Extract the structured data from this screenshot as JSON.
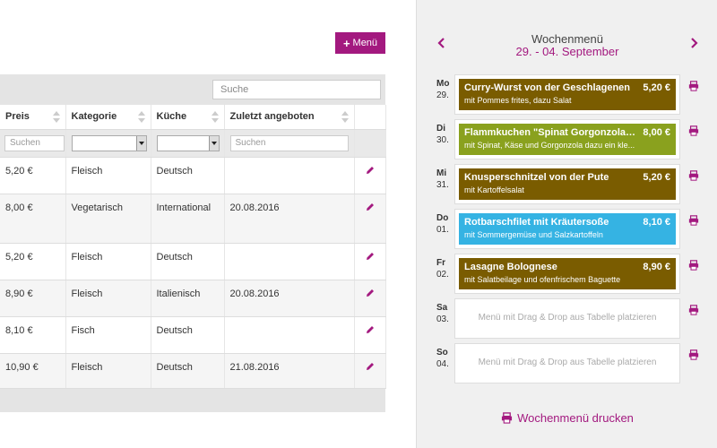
{
  "colors": {
    "accent": "#a3197f",
    "fleisch": "#7a5c00",
    "vegetarisch": "#8aa11e",
    "fisch": "#35b3e3"
  },
  "toolbar": {
    "add_menu_label": "Menü"
  },
  "table": {
    "search_placeholder": "Suche",
    "headers": [
      "Preis",
      "Kategorie",
      "Küche",
      "Zuletzt angeboten"
    ],
    "filter_placeholder": "Suchen",
    "rows": [
      {
        "price": "5,20 €",
        "category": "Fleisch",
        "cuisine": "Deutsch",
        "last": ""
      },
      {
        "price": "8,00 €",
        "category": "Vegetarisch",
        "cuisine": "International",
        "last": "20.08.2016"
      },
      {
        "price": "5,20 €",
        "category": "Fleisch",
        "cuisine": "Deutsch",
        "last": ""
      },
      {
        "price": "8,90 €",
        "category": "Fleisch",
        "cuisine": "Italienisch",
        "last": "20.08.2016"
      },
      {
        "price": "8,10 €",
        "category": "Fisch",
        "cuisine": "Deutsch",
        "last": ""
      },
      {
        "price": "10,90 €",
        "category": "Fleisch",
        "cuisine": "Deutsch",
        "last": "21.08.2016"
      }
    ]
  },
  "week": {
    "title": "Wochenmenü",
    "range": "29. - 04. September",
    "print_label": "Wochenmenü drucken",
    "empty_text": "Menü mit Drag & Drop aus Tabelle platzieren",
    "days": [
      {
        "abbr": "Mo",
        "date": "29.",
        "meal": {
          "name": "Curry-Wurst von der Geschlagenen",
          "price": "5,20 €",
          "side": "mit Pommes frites, dazu Salat",
          "color": "#7a5c00"
        }
      },
      {
        "abbr": "Di",
        "date": "30.",
        "meal": {
          "name": "Flammkuchen \"Spinat Gorgonzola\" ...",
          "price": "8,00 €",
          "side": "mit Spinat, Käse und Gorgonzola dazu ein kle...",
          "color": "#8aa11e"
        }
      },
      {
        "abbr": "Mi",
        "date": "31.",
        "meal": {
          "name": "Knusperschnitzel von der Pute",
          "price": "5,20 €",
          "side": "mit Kartoffelsalat",
          "color": "#7a5c00"
        }
      },
      {
        "abbr": "Do",
        "date": "01.",
        "meal": {
          "name": "Rotbarschfilet mit Kräutersoße",
          "price": "8,10 €",
          "side": "mit Sommergemüse und Salzkartoffeln",
          "color": "#35b3e3"
        }
      },
      {
        "abbr": "Fr",
        "date": "02.",
        "meal": {
          "name": "Lasagne Bolognese",
          "price": "8,90 €",
          "side": "mit Salatbeilage und ofenfrischem Baguette",
          "color": "#7a5c00"
        }
      },
      {
        "abbr": "Sa",
        "date": "03.",
        "meal": null
      },
      {
        "abbr": "So",
        "date": "04.",
        "meal": null
      }
    ]
  }
}
